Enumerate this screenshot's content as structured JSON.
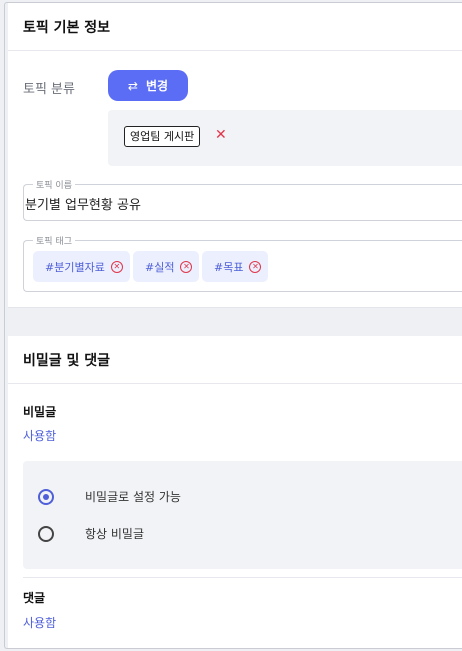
{
  "topic_info": {
    "title": "토픽 기본 정보",
    "category_label": "토픽 분류",
    "change_button": "변경",
    "selected_board": "영업팀 게시판",
    "remove_symbol": "✕",
    "name_legend": "토픽 이름",
    "name_value": "분기별 업무현황 공유",
    "tag_legend": "토픽 태그",
    "tags": [
      "#분기별자료",
      "#실적",
      "#목표"
    ]
  },
  "secret_comments": {
    "title": "비밀글 및 댓글",
    "secret_label": "비밀글",
    "secret_value": "사용함",
    "options": [
      "비밀글로 설정 가능",
      "항상 비밀글"
    ],
    "selected_option": 0,
    "comment_label": "댓글",
    "comment_value": "사용함"
  },
  "colors": {
    "accent": "#5b6cf5",
    "link": "#4e5fd9",
    "danger": "#e0364b"
  }
}
